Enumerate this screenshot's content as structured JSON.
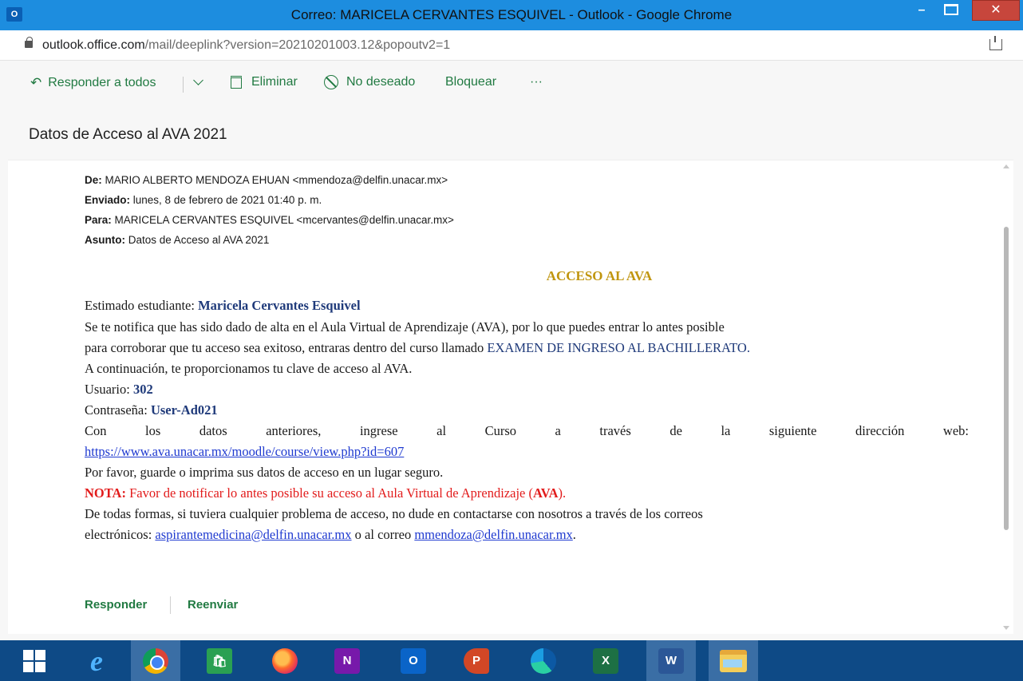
{
  "window": {
    "app_icon": "O",
    "title": "Correo: MARICELA CERVANTES ESQUIVEL - Outlook - Google Chrome",
    "minimize": "–",
    "close": "✕"
  },
  "address": {
    "host": "outlook.office.com",
    "path": "/mail/deeplink?version=20210201003.12&popoutv2=1"
  },
  "toolbar": {
    "reply_all_icon": "↶",
    "reply_all": "Responder a todos",
    "delete": "Eliminar",
    "junk": "No deseado",
    "block": "Bloquear",
    "more": "···"
  },
  "message": {
    "subject": "Datos de Acceso al AVA 2021",
    "headers": {
      "from_label": "De:",
      "from_value": "MARIO ALBERTO MENDOZA EHUAN <mmendoza@delfin.unacar.mx>",
      "sent_label": "Enviado:",
      "sent_value": "lunes, 8 de febrero de 2021 01:40 p. m.",
      "to_label": "Para:",
      "to_value": "MARICELA CERVANTES ESQUIVEL <mcervantes@delfin.unacar.mx>",
      "subject_label": "Asunto:",
      "subject_value": "Datos de Acceso al AVA 2021"
    },
    "body": {
      "heading": "ACCESO AL AVA",
      "greeting_label": "Estimado estudiante:",
      "greeting_name": "Maricela Cervantes Esquivel",
      "line1": "Se te notifica que has sido dado de alta en el Aula Virtual de Aprendizaje (AVA), por lo que puedes entrar lo antes posible",
      "line2": "para corroborar que tu acceso sea exitoso, entraras dentro del curso llamado",
      "course_name": "EXAMEN DE INGRESO AL BACHILLERATO.",
      "line3": "A continuación, te proporcionamos tu clave de acceso al AVA.",
      "user_label": "Usuario:",
      "user_value": "302",
      "password_label": "Contraseña:",
      "password_value": "User-Ad021",
      "line4_words": [
        "Con",
        "los",
        "datos",
        "anteriores,",
        "ingrese",
        "al",
        "Curso",
        "a",
        "través",
        "de",
        "la",
        "siguiente",
        "dirección",
        "web:"
      ],
      "course_url": "https://www.ava.unacar.mx/moodle/course/view.php?id=607",
      "line5": "Por favor, guarde o imprima sus datos de acceso en un lugar seguro.",
      "note_label": "NOTA:",
      "note_text": "Favor de notificar lo antes posible su acceso al Aula Virtual de Aprendizaje (",
      "note_ava": "AVA",
      "note_end": ").",
      "line6": "De todas formas, si tuviera cualquier problema de acceso, no dude en contactarse con nosotros a través de los correos",
      "line7_prefix": "electrónicos:",
      "email1": "aspirantemedicina@delfin.unacar.mx",
      "line7_mid": "o al correo",
      "email2": "mmendoza@delfin.unacar.mx",
      "line7_end": "."
    },
    "actions": {
      "reply": "Responder",
      "forward": "Reenviar"
    }
  },
  "taskbar": {
    "items": [
      {
        "name": "start",
        "icon": "windows-logo"
      },
      {
        "name": "internet-explorer",
        "icon": "e"
      },
      {
        "name": "chrome",
        "icon": "chrome"
      },
      {
        "name": "store",
        "icon": "store"
      },
      {
        "name": "firefox",
        "icon": "firefox"
      },
      {
        "name": "onenote",
        "icon": "N"
      },
      {
        "name": "outlook",
        "icon": "O"
      },
      {
        "name": "powerpoint",
        "icon": "P"
      },
      {
        "name": "edge",
        "icon": "edge"
      },
      {
        "name": "excel",
        "icon": "X"
      },
      {
        "name": "word",
        "icon": "W"
      },
      {
        "name": "file-explorer",
        "icon": "folder"
      }
    ]
  },
  "colors": {
    "titlebar": "#1d8ddf",
    "accent_green": "#217a42",
    "heading_gold": "#c0950e",
    "navy": "#1f3a7a",
    "link_blue": "#1f3ad0",
    "note_red": "#e21b1b",
    "taskbar": "#0e4a86"
  }
}
